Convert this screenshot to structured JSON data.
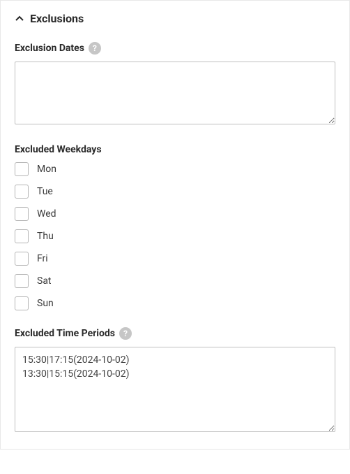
{
  "panel": {
    "title": "Exclusions"
  },
  "exclusionDates": {
    "label": "Exclusion Dates",
    "value": ""
  },
  "excludedWeekdays": {
    "label": "Excluded Weekdays",
    "items": [
      {
        "label": "Mon",
        "checked": false
      },
      {
        "label": "Tue",
        "checked": false
      },
      {
        "label": "Wed",
        "checked": false
      },
      {
        "label": "Thu",
        "checked": false
      },
      {
        "label": "Fri",
        "checked": false
      },
      {
        "label": "Sat",
        "checked": false
      },
      {
        "label": "Sun",
        "checked": false
      }
    ]
  },
  "excludedTimePeriods": {
    "label": "Excluded Time Periods",
    "value": "15:30|17:15(2024-10-02)\n13:30|15:15(2024-10-02)"
  },
  "icons": {
    "help": "?"
  }
}
